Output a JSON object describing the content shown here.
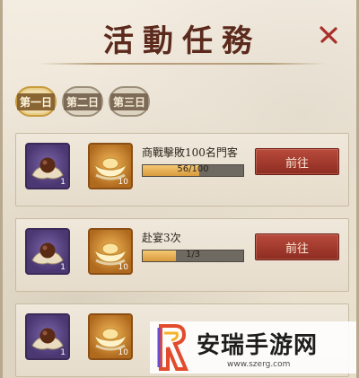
{
  "title": "活動任務",
  "days": [
    {
      "label": "第一日",
      "active": true
    },
    {
      "label": "第二日",
      "active": false
    },
    {
      "label": "第三日",
      "active": false
    }
  ],
  "quests": [
    {
      "title": "商戰擊敗100名門客",
      "progress_text": "56/100",
      "progress_fraction": 0.56,
      "button": "前往",
      "rewards": [
        {
          "icon": "chestnut-icon",
          "count": "1"
        },
        {
          "icon": "gold-ingot-icon",
          "count": "10"
        }
      ]
    },
    {
      "title": "赴宴3次",
      "progress_text": "1/3",
      "progress_fraction": 0.333,
      "button": "前往",
      "rewards": [
        {
          "icon": "chestnut-icon",
          "count": "1"
        },
        {
          "icon": "gold-ingot-icon",
          "count": "10"
        }
      ]
    },
    {
      "title": "",
      "progress_text": "",
      "progress_fraction": 0,
      "button": "",
      "rewards": [
        {
          "icon": "chestnut-icon",
          "count": "1"
        },
        {
          "icon": "gold-ingot-icon",
          "count": "10"
        }
      ]
    }
  ],
  "watermark": {
    "name": "安瑞手游网",
    "url": "www.szerg.com"
  },
  "colors": {
    "title": "#5b2a1c",
    "go_button": "#a33a2e",
    "progress_fill": "#e0a84a"
  }
}
